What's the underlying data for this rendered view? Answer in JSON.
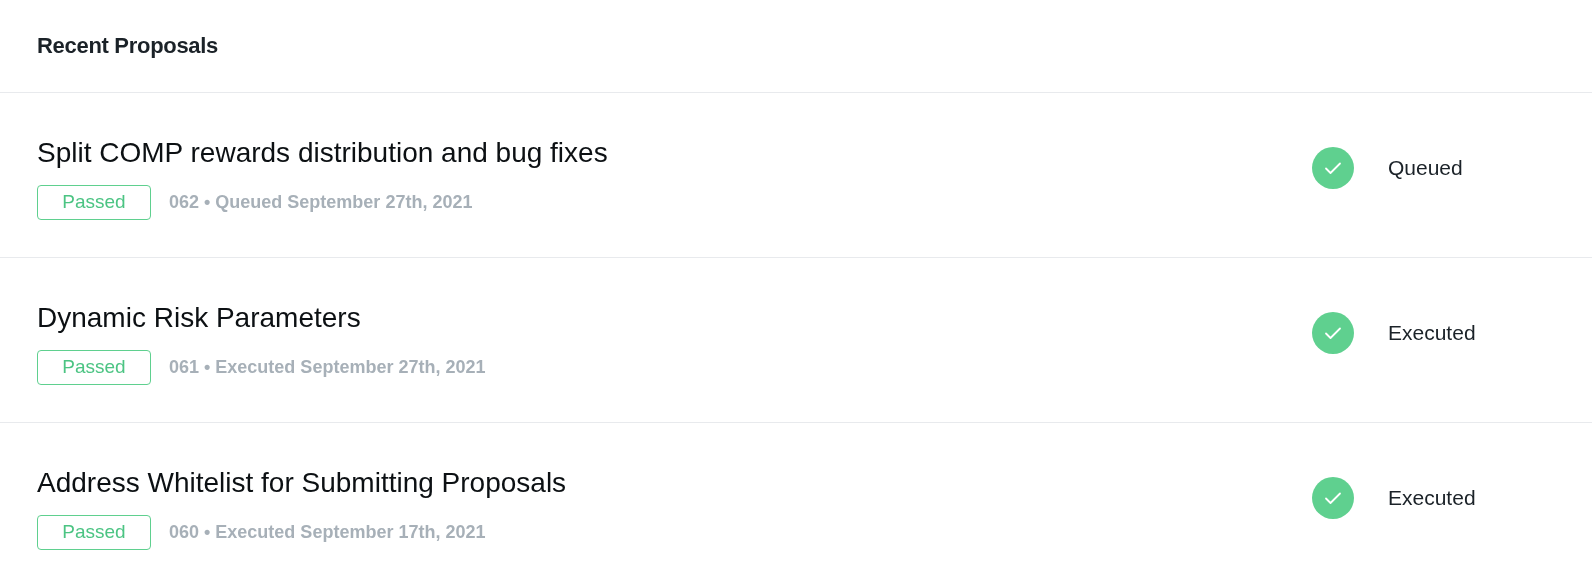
{
  "panel": {
    "title": "Recent Proposals"
  },
  "proposals": [
    {
      "title": "Split COMP rewards distribution and bug fixes",
      "badge": "Passed",
      "meta": "062 • Queued September 27th, 2021",
      "status": "Queued"
    },
    {
      "title": "Dynamic Risk Parameters",
      "badge": "Passed",
      "meta": "061 • Executed September 27th, 2021",
      "status": "Executed"
    },
    {
      "title": "Address Whitelist for Submitting Proposals",
      "badge": "Passed",
      "meta": "060 • Executed September 17th, 2021",
      "status": "Executed"
    }
  ]
}
